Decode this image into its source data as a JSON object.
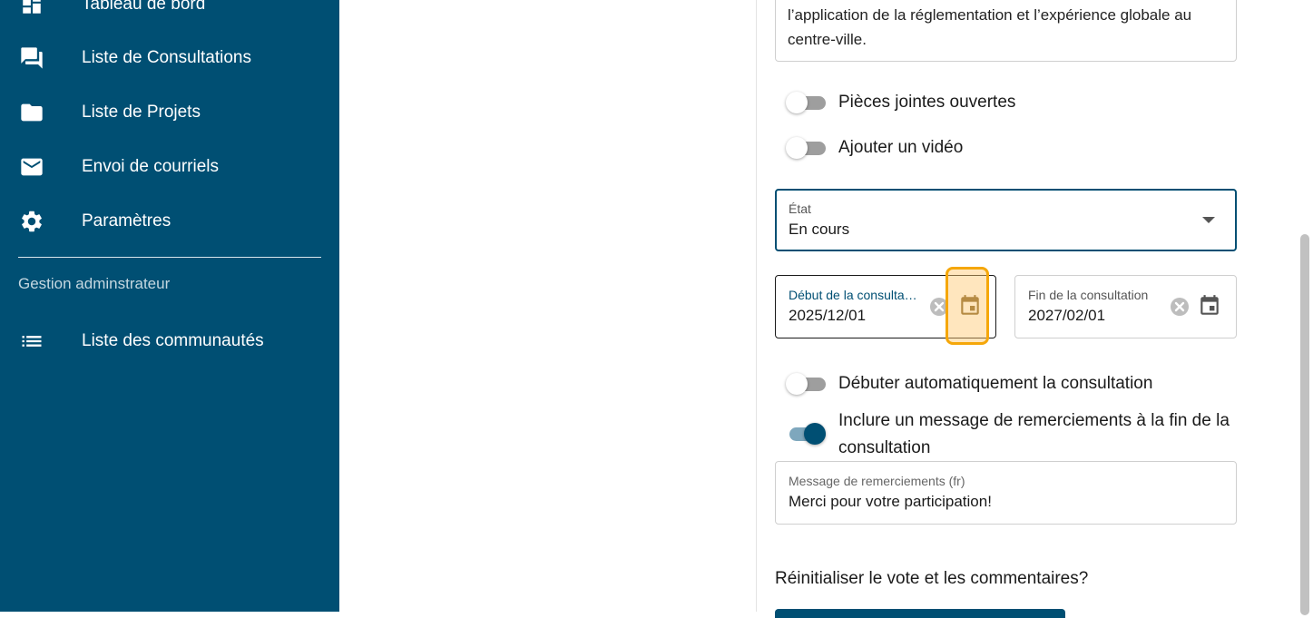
{
  "sidebar": {
    "items": [
      {
        "label": "Tableau de bord",
        "icon": "dashboard-icon"
      },
      {
        "label": "Liste de Consultations",
        "icon": "forum-icon"
      },
      {
        "label": "Liste de Projets",
        "icon": "folder-icon"
      },
      {
        "label": "Envoi de courriels",
        "icon": "mail-icon"
      },
      {
        "label": "Paramètres",
        "icon": "gear-icon"
      }
    ],
    "admin_section_label": "Gestion adminstrateur",
    "admin_items": [
      {
        "label": "Liste des communautés",
        "icon": "list-icon"
      }
    ],
    "background": "#004f73"
  },
  "form": {
    "description_text": "l’application de la réglementation et l’expérience globale au centre-ville.",
    "toggles": [
      {
        "label": "Pièces jointes ouvertes",
        "checked": false
      },
      {
        "label": "Ajouter un vidéo",
        "checked": false
      },
      {
        "label": "Débuter automatiquement la consultation",
        "checked": false
      },
      {
        "label": "Inclure un message de remerciements à la fin de la consultation",
        "checked": true
      }
    ],
    "state_select": {
      "label": "État",
      "value": "En cours"
    },
    "start_date": {
      "label": "Début de la consultation",
      "value": "2025/12/01"
    },
    "end_date": {
      "label": "Fin de la consultation",
      "value": "2027/02/01"
    },
    "thanks_message": {
      "label": "Message de remerciements (fr)",
      "value": "Merci pour votre participation!"
    },
    "reset_question": "Réinitialiser le vote et les commentaires?"
  },
  "colors": {
    "accent": "#004f73",
    "highlight": "#f5a70a"
  }
}
